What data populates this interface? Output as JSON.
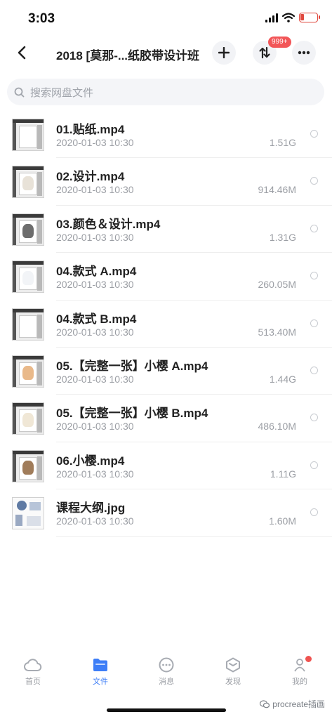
{
  "status": {
    "time": "3:03"
  },
  "header": {
    "title": "2018 [莫那-...纸胶带设计班",
    "transfer_badge": "999+"
  },
  "search": {
    "placeholder": "搜索网盘文件"
  },
  "files": [
    {
      "name": "01.贴纸.mp4",
      "date": "2020-01-03 10:30",
      "size": "1.51G",
      "art": "#ffffff"
    },
    {
      "name": "02.设计.mp4",
      "date": "2020-01-03 10:30",
      "size": "914.46M",
      "art": "#e8e2d8"
    },
    {
      "name": "03.颜色＆设计.mp4",
      "date": "2020-01-03 10:30",
      "size": "1.31G",
      "art": "#6d6d6d"
    },
    {
      "name": "04.款式 A.mp4",
      "date": "2020-01-03 10:30",
      "size": "260.05M",
      "art": "#f2f4f7"
    },
    {
      "name": "04.款式 B.mp4",
      "date": "2020-01-03 10:30",
      "size": "513.40M",
      "art": "#ffffff"
    },
    {
      "name": "05.【完整一张】小樱 A.mp4",
      "date": "2020-01-03 10:30",
      "size": "1.44G",
      "art": "#e9b98a"
    },
    {
      "name": "05.【完整一张】小樱 B.mp4",
      "date": "2020-01-03 10:30",
      "size": "486.10M",
      "art": "#f0e7d6"
    },
    {
      "name": "06.小樱.mp4",
      "date": "2020-01-03 10:30",
      "size": "1.11G",
      "art": "#a07c5a"
    },
    {
      "name": "课程大纲.jpg",
      "date": "2020-01-03 10:30",
      "size": "1.60M",
      "art": "image"
    }
  ],
  "tabs": [
    {
      "label": "首页",
      "icon": "cloud-icon"
    },
    {
      "label": "文件",
      "icon": "folder-icon",
      "active": true
    },
    {
      "label": "消息",
      "icon": "chat-bubble-icon"
    },
    {
      "label": "发现",
      "icon": "cube-icon"
    },
    {
      "label": "我的",
      "icon": "avatar-icon"
    }
  ],
  "watermark": {
    "text": "procreate插画"
  },
  "colors": {
    "accent": "#3d7ef7",
    "badge": "#f25658",
    "battery": "#e0483e"
  }
}
